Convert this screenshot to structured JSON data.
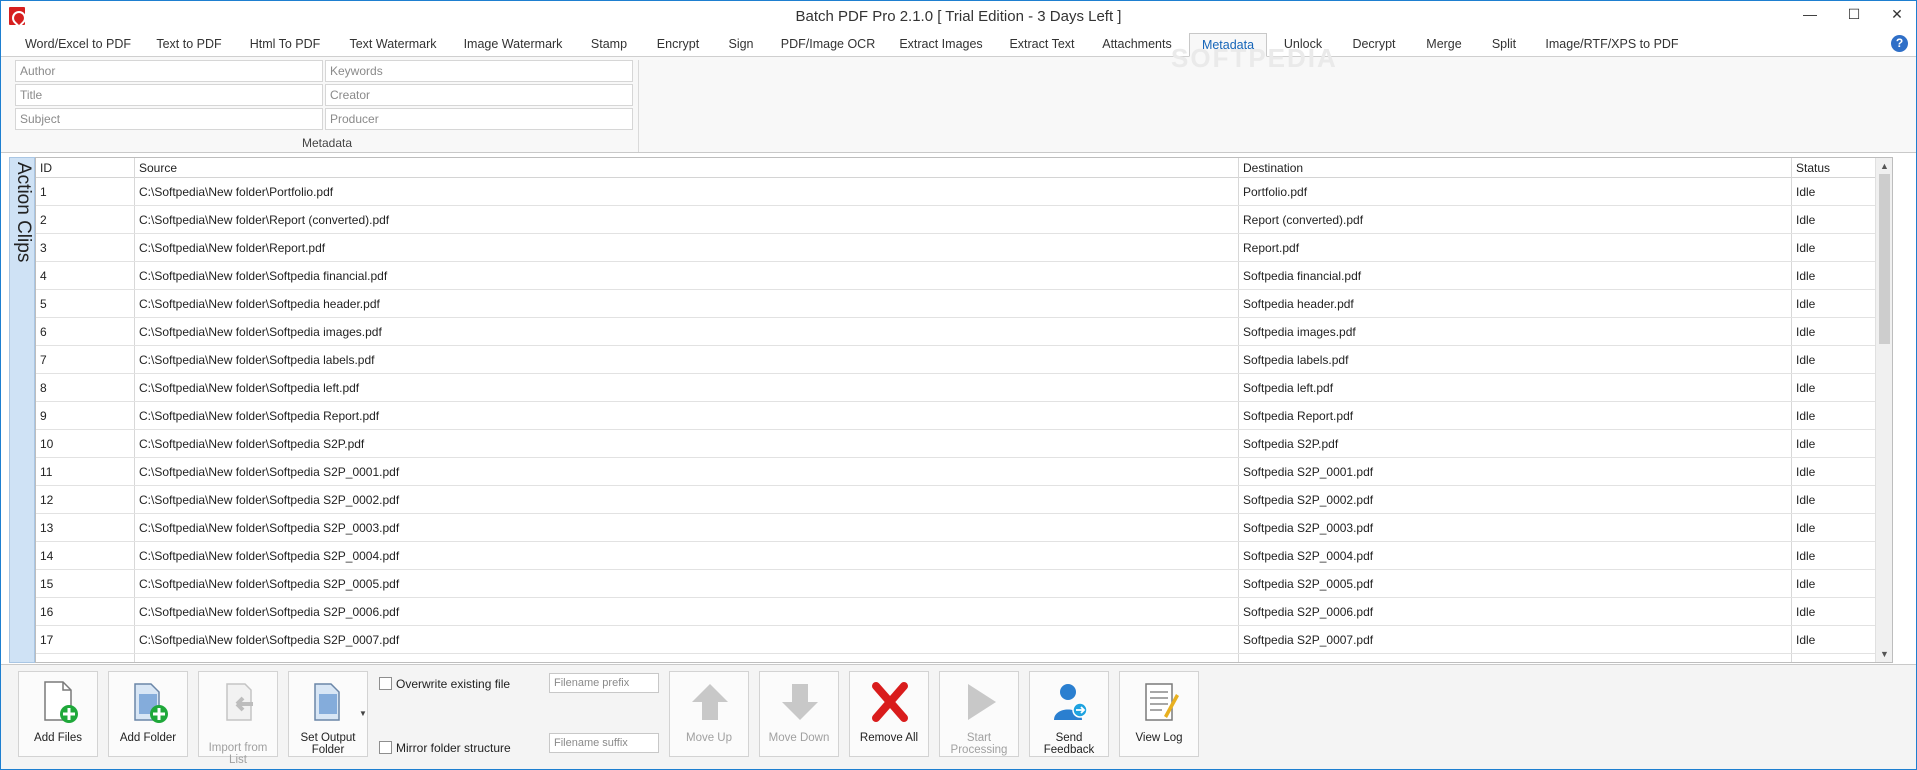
{
  "window": {
    "title": "Batch PDF Pro 2.1.0 [ Trial Edition - 3 Days Left ]",
    "minimize": "—",
    "maximize": "☐",
    "close": "✕"
  },
  "tabs": [
    {
      "label": "Word/Excel to PDF"
    },
    {
      "label": "Text to PDF"
    },
    {
      "label": "Html To PDF"
    },
    {
      "label": "Text Watermark"
    },
    {
      "label": "Image Watermark"
    },
    {
      "label": "Stamp"
    },
    {
      "label": "Encrypt"
    },
    {
      "label": "Sign"
    },
    {
      "label": "PDF/Image OCR"
    },
    {
      "label": "Extract Images"
    },
    {
      "label": "Extract Text"
    },
    {
      "label": "Attachments"
    },
    {
      "label": "Metadata"
    },
    {
      "label": "Unlock"
    },
    {
      "label": "Decrypt"
    },
    {
      "label": "Merge"
    },
    {
      "label": "Split"
    },
    {
      "label": "Image/RTF/XPS to PDF"
    }
  ],
  "active_tab": "Metadata",
  "help": "?",
  "watermark": "SOFTPEDIA",
  "metadata": {
    "author_placeholder": "Author",
    "keywords_placeholder": "Keywords",
    "title_placeholder": "Title",
    "creator_placeholder": "Creator",
    "subject_placeholder": "Subject",
    "producer_placeholder": "Producer",
    "group_label": "Metadata"
  },
  "side_panel": {
    "label": "Action Clips"
  },
  "table": {
    "columns": [
      "ID",
      "Source",
      "Destination",
      "Status"
    ],
    "rows": [
      [
        "1",
        "C:\\Softpedia\\New folder\\Portfolio.pdf",
        "Portfolio.pdf",
        "Idle"
      ],
      [
        "2",
        "C:\\Softpedia\\New folder\\Report (converted).pdf",
        "Report (converted).pdf",
        "Idle"
      ],
      [
        "3",
        "C:\\Softpedia\\New folder\\Report.pdf",
        "Report.pdf",
        "Idle"
      ],
      [
        "4",
        "C:\\Softpedia\\New folder\\Softpedia financial.pdf",
        "Softpedia financial.pdf",
        "Idle"
      ],
      [
        "5",
        "C:\\Softpedia\\New folder\\Softpedia header.pdf",
        "Softpedia header.pdf",
        "Idle"
      ],
      [
        "6",
        "C:\\Softpedia\\New folder\\Softpedia images.pdf",
        "Softpedia images.pdf",
        "Idle"
      ],
      [
        "7",
        "C:\\Softpedia\\New folder\\Softpedia labels.pdf",
        "Softpedia labels.pdf",
        "Idle"
      ],
      [
        "8",
        "C:\\Softpedia\\New folder\\Softpedia left.pdf",
        "Softpedia left.pdf",
        "Idle"
      ],
      [
        "9",
        "C:\\Softpedia\\New folder\\Softpedia Report.pdf",
        "Softpedia Report.pdf",
        "Idle"
      ],
      [
        "10",
        "C:\\Softpedia\\New folder\\Softpedia S2P.pdf",
        "Softpedia S2P.pdf",
        "Idle"
      ],
      [
        "11",
        "C:\\Softpedia\\New folder\\Softpedia S2P_0001.pdf",
        "Softpedia S2P_0001.pdf",
        "Idle"
      ],
      [
        "12",
        "C:\\Softpedia\\New folder\\Softpedia S2P_0002.pdf",
        "Softpedia S2P_0002.pdf",
        "Idle"
      ],
      [
        "13",
        "C:\\Softpedia\\New folder\\Softpedia S2P_0003.pdf",
        "Softpedia S2P_0003.pdf",
        "Idle"
      ],
      [
        "14",
        "C:\\Softpedia\\New folder\\Softpedia S2P_0004.pdf",
        "Softpedia S2P_0004.pdf",
        "Idle"
      ],
      [
        "15",
        "C:\\Softpedia\\New folder\\Softpedia S2P_0005.pdf",
        "Softpedia S2P_0005.pdf",
        "Idle"
      ],
      [
        "16",
        "C:\\Softpedia\\New folder\\Softpedia S2P_0006.pdf",
        "Softpedia S2P_0006.pdf",
        "Idle"
      ],
      [
        "17",
        "C:\\Softpedia\\New folder\\Softpedia S2P_0007.pdf",
        "Softpedia S2P_0007.pdf",
        "Idle"
      ]
    ]
  },
  "toolbar": {
    "add_files": "Add Files",
    "add_folder": "Add Folder",
    "import_from_list": "Import from List",
    "set_output_folder": "Set Output Folder",
    "overwrite_existing": "Overwrite existing file",
    "mirror_folder": "Mirror folder structure",
    "filename_prefix_placeholder": "Filename prefix",
    "filename_suffix_placeholder": "Filename suffix",
    "move_up": "Move Up",
    "move_down": "Move Down",
    "remove_all": "Remove All",
    "start_processing": "Start Processing",
    "send_feedback": "Send Feedback",
    "view_log": "View Log"
  },
  "colors": {
    "accent": "#1e7fd0",
    "active_tab_text": "#1565b8",
    "side_panel": "#cfe2f5",
    "add_green": "#1fa83a",
    "remove_red": "#d91c1c"
  }
}
